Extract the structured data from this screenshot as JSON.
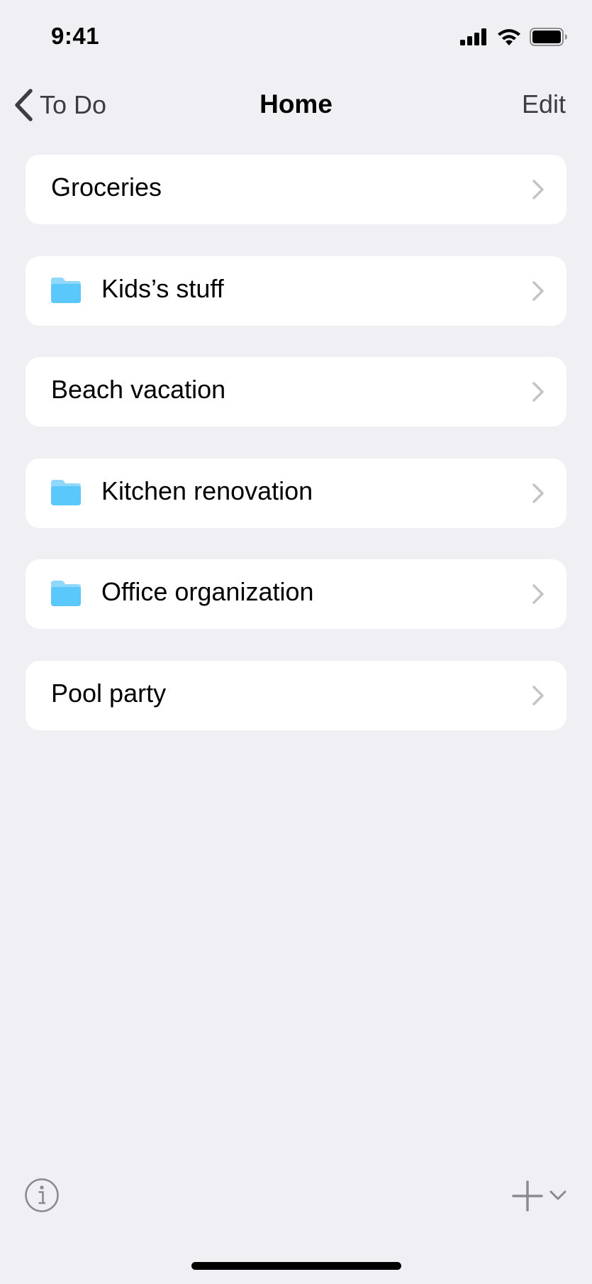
{
  "status_bar": {
    "time": "9:41",
    "icons": [
      "cellular-signal-icon",
      "wifi-icon",
      "battery-icon"
    ]
  },
  "nav": {
    "back_label": "To Do",
    "title": "Home",
    "edit_label": "Edit"
  },
  "colors": {
    "background": "#efeff4",
    "row_background": "#ffffff",
    "folder": "#5ac8fa",
    "chevron": "#c4c4c7",
    "secondary_text": "#3c3c43"
  },
  "lists": [
    {
      "label": "Groceries",
      "icon": ""
    },
    {
      "label": "Kids’s stuff",
      "icon": "folder-icon"
    },
    {
      "label": "Beach vacation",
      "icon": ""
    },
    {
      "label": "Kitchen renovation",
      "icon": "folder-icon"
    },
    {
      "label": "Office organization",
      "icon": "folder-icon"
    },
    {
      "label": "Pool party",
      "icon": ""
    }
  ],
  "toolbar": {
    "left_icon": "info-icon",
    "right_icons": [
      "plus-icon",
      "chevron-down-icon"
    ]
  }
}
